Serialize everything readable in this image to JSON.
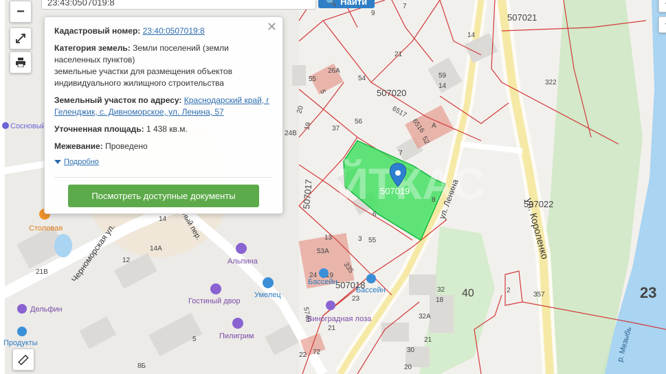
{
  "search": {
    "value": "23:43:0507019:8",
    "button_label": "Найти"
  },
  "controls": {
    "zoom_in": "+",
    "zoom_out": "−"
  },
  "popup": {
    "cadastral_label": "Кадастровый номер:",
    "cadastral_value": "23:40:0507019:8",
    "category_label": "Категория земель:",
    "category_value": "Земли поселений (земли населенных пунктов)",
    "use_value": "земельные участки для размещения объектов индивидуального жилищного строительства",
    "address_label": "Земельный участок по адресу:",
    "address_value": "Краснодарский край, г Геленджик, с. Дивноморское, ул. Ленина, 57",
    "area_label": "Уточненная площадь:",
    "area_value": "1 438 кв.м.",
    "survey_label": "Межевание:",
    "survey_value": "Проведено",
    "more_link": "Подробно",
    "docs_button": "Посмотреть доступные документы",
    "close": "✕"
  },
  "map": {
    "street_labels": [
      "Черноморская ул.",
      "ул. Ленина",
      "ул. Короленко",
      "р. Мезыбь",
      "ный пер."
    ],
    "quarter_labels": [
      "507021",
      "507020",
      "507019",
      "507017",
      "507018",
      "507022"
    ],
    "poi_labels": [
      "Сосновый",
      "Столовая",
      "Альпина",
      "Бассейн",
      "Бассейн",
      "Умелец",
      "Гостиный двор",
      "Виноградная лоза",
      "Пилигрим",
      "Дельфин",
      "Продукты"
    ],
    "numbers": {
      "n1": "7",
      "n2": "9",
      "n3": "14",
      "n4": "21",
      "n5": "59",
      "n6": "14",
      "n7": "54",
      "n8": "26А",
      "n9": "55",
      "n10": "5",
      "n11": "322",
      "n12": "6517",
      "n13": "6516",
      "n14": "52",
      "n15": "А",
      "n16": "56",
      "n17": "37",
      "n18": "19",
      "n19": "24В",
      "n20": "7",
      "n21": "8",
      "n22": "6",
      "n23": "3",
      "n24": "55",
      "n25": "13",
      "n26": "53А",
      "n27": "335",
      "n28": "24",
      "n29": "19",
      "n30": "23",
      "n31": "5740",
      "n32": "21",
      "n33": "32",
      "n34": "18",
      "n35": "40",
      "n36": "2",
      "n37": "357",
      "n38": "23",
      "n39": "32А",
      "n40": "21",
      "n41": "30",
      "n42": "22",
      "n43": "72",
      "n44": "20",
      "n45": "14",
      "n46": "14А",
      "n47": "12",
      "n48": "21В",
      "n49": "5",
      "n50": "8Б",
      "n51": "20"
    }
  },
  "colors": {
    "parcel": "#39e05a",
    "boundary": "#d23a3a",
    "water": "#a9d4f2",
    "road": "#f6e9a6",
    "pin": "#2d7fd0",
    "button": "#5daa4a"
  }
}
